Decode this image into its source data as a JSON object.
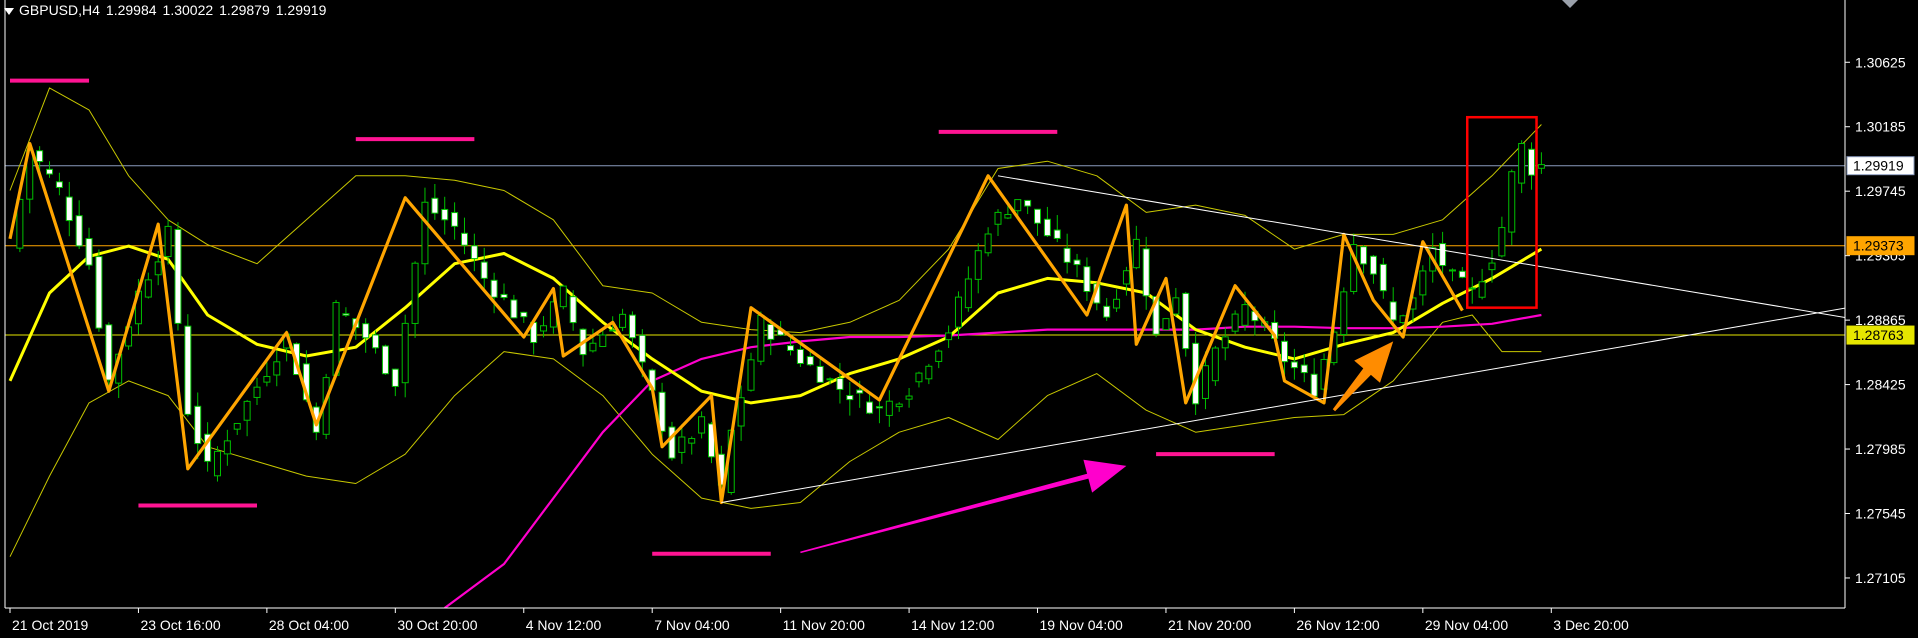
{
  "header": {
    "symbol": "GBPUSD,H4",
    "open": "1.29984",
    "high": "1.30022",
    "low": "1.29879",
    "close": "1.29919"
  },
  "colors": {
    "background": "#000000",
    "frame": "#ffffff",
    "bull_candle": "#00c000",
    "bear_candle": "#ffffff",
    "zigzag": "#ffa500",
    "moving_average": "#ffff00",
    "bollinger": "#c8c800",
    "long_ma": "#ff00cc",
    "level_lines": "#ff1493",
    "trendline": "#ffffff",
    "box": "#ff0000",
    "current_price_line": "#8a9bbd",
    "level_orange": "#ffa500",
    "level_yellow": "#e6e600"
  },
  "chart_data": {
    "type": "candlestick",
    "symbol": "GBPUSD",
    "timeframe": "H4",
    "ylim": [
      1.269,
      1.3105
    ],
    "y_ticks": [
      "1.30625",
      "1.30185",
      "1.29745",
      "1.29305",
      "1.28865",
      "1.28425",
      "1.27985",
      "1.27545",
      "1.27105"
    ],
    "x_ticks": [
      {
        "i": 0,
        "label": "21 Oct 2019"
      },
      {
        "i": 13,
        "label": "23 Oct 16:00"
      },
      {
        "i": 26,
        "label": "28 Oct 04:00"
      },
      {
        "i": 39,
        "label": "30 Oct 20:00"
      },
      {
        "i": 52,
        "label": "4 Nov 12:00"
      },
      {
        "i": 65,
        "label": "7 Nov 04:00"
      },
      {
        "i": 78,
        "label": "11 Nov 20:00"
      },
      {
        "i": 91,
        "label": "14 Nov 12:00"
      },
      {
        "i": 104,
        "label": "19 Nov 04:00"
      },
      {
        "i": 117,
        "label": "21 Nov 20:00"
      },
      {
        "i": 130,
        "label": "26 Nov 12:00"
      },
      {
        "i": 143,
        "label": "29 Nov 04:00"
      },
      {
        "i": 156,
        "label": "3 Dec 20:00"
      }
    ],
    "price_levels": [
      {
        "value": 1.29919,
        "label": "1.29919",
        "kind": "current"
      },
      {
        "value": 1.29373,
        "label": "1.29373",
        "kind": "orange"
      },
      {
        "value": 1.28763,
        "label": "1.28763",
        "kind": "yellow"
      }
    ],
    "close_path": [
      [
        0,
        1.2935
      ],
      [
        2,
        1.3003
      ],
      [
        5,
        1.2975
      ],
      [
        8,
        1.2925
      ],
      [
        10,
        1.2845
      ],
      [
        13,
        1.2905
      ],
      [
        16,
        1.2945
      ],
      [
        18,
        1.2825
      ],
      [
        20,
        1.2785
      ],
      [
        24,
        1.283
      ],
      [
        28,
        1.2875
      ],
      [
        31,
        1.281
      ],
      [
        33,
        1.2895
      ],
      [
        36,
        1.2875
      ],
      [
        39,
        1.2845
      ],
      [
        42,
        1.2965
      ],
      [
        45,
        1.295
      ],
      [
        48,
        1.2915
      ],
      [
        50,
        1.29
      ],
      [
        53,
        1.2875
      ],
      [
        56,
        1.2905
      ],
      [
        58,
        1.2865
      ],
      [
        62,
        1.289
      ],
      [
        65,
        1.2835
      ],
      [
        67,
        1.2795
      ],
      [
        70,
        1.2815
      ],
      [
        72,
        1.277
      ],
      [
        73,
        1.281
      ],
      [
        76,
        1.2885
      ],
      [
        80,
        1.286
      ],
      [
        84,
        1.284
      ],
      [
        88,
        1.2825
      ],
      [
        91,
        1.284
      ],
      [
        95,
        1.288
      ],
      [
        99,
        1.295
      ],
      [
        102,
        1.297
      ],
      [
        105,
        1.2945
      ],
      [
        108,
        1.292
      ],
      [
        111,
        1.289
      ],
      [
        114,
        1.294
      ],
      [
        116,
        1.2875
      ],
      [
        118,
        1.2905
      ],
      [
        120,
        1.2835
      ],
      [
        122,
        1.2865
      ],
      [
        125,
        1.2895
      ],
      [
        127,
        1.288
      ],
      [
        129,
        1.286
      ],
      [
        132,
        1.284
      ],
      [
        134,
        1.288
      ],
      [
        136,
        1.294
      ],
      [
        138,
        1.292
      ],
      [
        140,
        1.2885
      ],
      [
        142,
        1.29
      ],
      [
        144,
        1.2935
      ],
      [
        146,
        1.2915
      ],
      [
        148,
        1.2905
      ],
      [
        150,
        1.293
      ],
      [
        151,
        1.295
      ],
      [
        152,
        1.2985
      ],
      [
        153,
        1.3005
      ],
      [
        154,
        1.299
      ],
      [
        155,
        1.2992
      ]
    ],
    "zigzag": [
      [
        0,
        1.2942
      ],
      [
        2,
        1.3007
      ],
      [
        10,
        1.2838
      ],
      [
        15,
        1.2952
      ],
      [
        18,
        1.2785
      ],
      [
        28,
        1.2878
      ],
      [
        31,
        1.2815
      ],
      [
        40,
        1.297
      ],
      [
        52,
        1.2875
      ],
      [
        55,
        1.2908
      ],
      [
        56,
        1.2862
      ],
      [
        61,
        1.2885
      ],
      [
        65,
        1.284
      ],
      [
        66,
        1.28
      ],
      [
        71,
        1.2835
      ],
      [
        72,
        1.2762
      ],
      [
        75,
        1.2895
      ],
      [
        88,
        1.2832
      ],
      [
        99,
        1.2985
      ],
      [
        109,
        1.289
      ],
      [
        113,
        1.2965
      ],
      [
        114,
        1.287
      ],
      [
        117,
        1.2915
      ],
      [
        119,
        1.283
      ],
      [
        124,
        1.291
      ],
      [
        128,
        1.2876
      ],
      [
        129,
        1.2845
      ],
      [
        133,
        1.283
      ],
      [
        135,
        1.2945
      ],
      [
        138,
        1.29
      ],
      [
        141,
        1.2875
      ],
      [
        143,
        1.294
      ],
      [
        147,
        1.2893
      ]
    ],
    "moving_average": [
      [
        0,
        1.2845
      ],
      [
        4,
        1.2905
      ],
      [
        8,
        1.293
      ],
      [
        12,
        1.2937
      ],
      [
        16,
        1.2928
      ],
      [
        20,
        1.289
      ],
      [
        25,
        1.287
      ],
      [
        30,
        1.2862
      ],
      [
        35,
        1.2868
      ],
      [
        40,
        1.2895
      ],
      [
        45,
        1.2925
      ],
      [
        50,
        1.2932
      ],
      [
        55,
        1.2915
      ],
      [
        60,
        1.2885
      ],
      [
        65,
        1.286
      ],
      [
        70,
        1.2838
      ],
      [
        75,
        1.283
      ],
      [
        80,
        1.2835
      ],
      [
        85,
        1.285
      ],
      [
        90,
        1.286
      ],
      [
        95,
        1.2875
      ],
      [
        100,
        1.2905
      ],
      [
        105,
        1.2915
      ],
      [
        110,
        1.2912
      ],
      [
        115,
        1.2905
      ],
      [
        120,
        1.288
      ],
      [
        125,
        1.2868
      ],
      [
        130,
        1.286
      ],
      [
        135,
        1.287
      ],
      [
        140,
        1.2878
      ],
      [
        145,
        1.2898
      ],
      [
        150,
        1.2915
      ],
      [
        155,
        1.2935
      ]
    ],
    "bollinger_upper": [
      [
        0,
        1.2975
      ],
      [
        4,
        1.3045
      ],
      [
        8,
        1.303
      ],
      [
        12,
        1.2985
      ],
      [
        16,
        1.2955
      ],
      [
        20,
        1.2938
      ],
      [
        25,
        1.2925
      ],
      [
        30,
        1.2955
      ],
      [
        35,
        1.2985
      ],
      [
        40,
        1.2985
      ],
      [
        45,
        1.2982
      ],
      [
        50,
        1.2975
      ],
      [
        55,
        1.2955
      ],
      [
        60,
        1.291
      ],
      [
        65,
        1.2905
      ],
      [
        70,
        1.2885
      ],
      [
        75,
        1.288
      ],
      [
        80,
        1.2878
      ],
      [
        85,
        1.2885
      ],
      [
        90,
        1.29
      ],
      [
        95,
        1.2935
      ],
      [
        100,
        1.299
      ],
      [
        105,
        1.2995
      ],
      [
        110,
        1.2985
      ],
      [
        115,
        1.296
      ],
      [
        120,
        1.2965
      ],
      [
        125,
        1.2958
      ],
      [
        130,
        1.2935
      ],
      [
        135,
        1.2945
      ],
      [
        140,
        1.2945
      ],
      [
        145,
        1.2955
      ],
      [
        150,
        1.2985
      ],
      [
        155,
        1.302
      ]
    ],
    "bollinger_lower": [
      [
        0,
        1.2725
      ],
      [
        4,
        1.278
      ],
      [
        8,
        1.283
      ],
      [
        12,
        1.2845
      ],
      [
        16,
        1.2835
      ],
      [
        20,
        1.28
      ],
      [
        25,
        1.279
      ],
      [
        30,
        1.278
      ],
      [
        35,
        1.2775
      ],
      [
        40,
        1.2795
      ],
      [
        45,
        1.2835
      ],
      [
        50,
        1.2865
      ],
      [
        55,
        1.286
      ],
      [
        60,
        1.2835
      ],
      [
        65,
        1.2795
      ],
      [
        70,
        1.2765
      ],
      [
        75,
        1.2758
      ],
      [
        80,
        1.2762
      ],
      [
        85,
        1.279
      ],
      [
        90,
        1.281
      ],
      [
        95,
        1.282
      ],
      [
        100,
        1.2805
      ],
      [
        105,
        1.2835
      ],
      [
        110,
        1.285
      ],
      [
        115,
        1.2825
      ],
      [
        120,
        1.281
      ],
      [
        125,
        1.2815
      ],
      [
        130,
        1.282
      ],
      [
        135,
        1.2822
      ],
      [
        140,
        1.2845
      ],
      [
        145,
        1.2885
      ],
      [
        148,
        1.289
      ],
      [
        151,
        1.2865
      ],
      [
        155,
        1.2865
      ]
    ],
    "long_ma": [
      [
        44,
        1.269
      ],
      [
        50,
        1.272
      ],
      [
        55,
        1.2765
      ],
      [
        60,
        1.281
      ],
      [
        65,
        1.2845
      ],
      [
        70,
        1.286
      ],
      [
        75,
        1.2868
      ],
      [
        80,
        1.2872
      ],
      [
        85,
        1.2875
      ],
      [
        90,
        1.2875
      ],
      [
        95,
        1.2876
      ],
      [
        100,
        1.2878
      ],
      [
        105,
        1.288
      ],
      [
        110,
        1.288
      ],
      [
        115,
        1.288
      ],
      [
        120,
        1.288
      ],
      [
        125,
        1.2882
      ],
      [
        130,
        1.2882
      ],
      [
        135,
        1.2881
      ],
      [
        140,
        1.2881
      ],
      [
        145,
        1.2882
      ],
      [
        150,
        1.2884
      ],
      [
        155,
        1.289
      ]
    ],
    "trendlines": [
      [
        [
          72,
          1.2762
        ],
        [
          186,
          1.2895
        ]
      ],
      [
        [
          100,
          1.2985
        ],
        [
          186,
          1.2888
        ]
      ]
    ],
    "level_segments": [
      {
        "i0": 0,
        "i1": 8,
        "y": 1.305
      },
      {
        "i0": 35,
        "i1": 47,
        "y": 1.301
      },
      {
        "i0": 94,
        "i1": 106,
        "y": 1.3015
      },
      {
        "i0": 13,
        "i1": 25,
        "y": 1.276
      },
      {
        "i0": 65,
        "i1": 77,
        "y": 1.2727
      },
      {
        "i0": 116,
        "i1": 128,
        "y": 1.2795
      }
    ],
    "arrows": [
      {
        "from": [
          80,
          1.2728
        ],
        "to": [
          113,
          1.2787
        ],
        "color": "#ff00cc"
      },
      {
        "from": [
          134,
          1.2825
        ],
        "to": [
          140,
          1.2872
        ],
        "color": "#ff8c00"
      }
    ],
    "box": {
      "i0": 148,
      "i1": 154,
      "y0": 1.2895,
      "y1": 1.3025
    }
  }
}
